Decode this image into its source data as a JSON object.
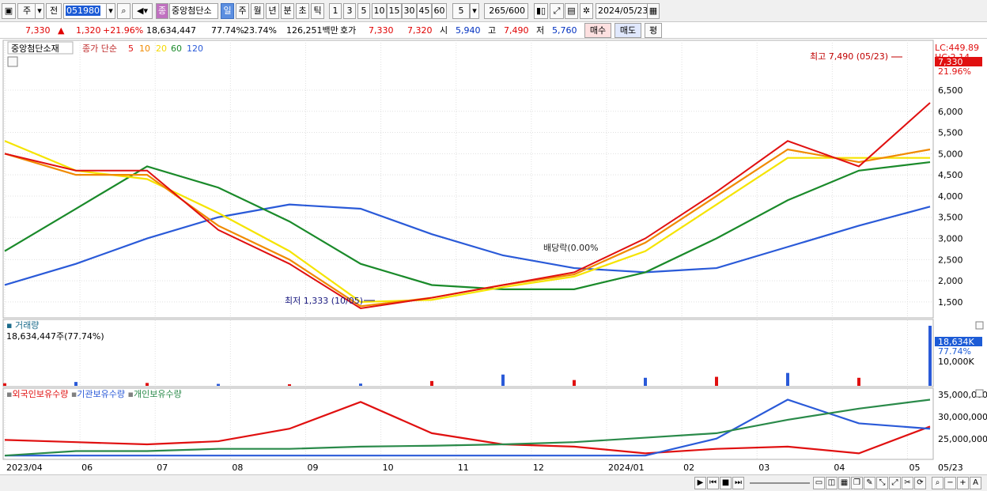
{
  "toolbar": {
    "market_label": "주",
    "prev_label": "전",
    "stock_code": "051980",
    "stock_name": "중앙첨단소",
    "stock_badge": "종",
    "periods": [
      "일",
      "주",
      "월",
      "년",
      "분",
      "초",
      "틱"
    ],
    "active_period": "일",
    "intervals": [
      "1",
      "3",
      "5",
      "10",
      "15",
      "30",
      "45",
      "60"
    ],
    "interval_select": "5",
    "count_display": "265/600",
    "date_field": "2024/05/23"
  },
  "quote": {
    "price": "7,330",
    "change_symbol": "▲",
    "change": "1,320",
    "change_pct": "+21.96%",
    "volume": "18,634,447",
    "turnover_pct": "77.74%",
    "rate2": "23.74%",
    "amount": "126,251백만",
    "hoga_label": "호가",
    "ask": "7,330",
    "bid": "7,320",
    "open_label": "시",
    "open": "5,940",
    "high_label": "고",
    "high": "7,490",
    "low_label": "저",
    "low": "5,760",
    "buy_label": "매수",
    "sell_label": "매도",
    "avg_label": "평"
  },
  "price_panel": {
    "stock_label": "중앙첨단소재",
    "ma_label": "종가 단순",
    "ma_periods": [
      "5",
      "10",
      "20",
      "60",
      "120"
    ],
    "lc_label": "LC:449.89",
    "hc_label": "HC:2.14",
    "current_tag": "7,330",
    "current_pct_tag": "21.96%",
    "high_annotation": "최고 7,490 (05/23)",
    "low_annotation": "최저 1,333 (10/05)",
    "dividend_annotation": "배당락(0.00%",
    "y_ticks": [
      "6,500",
      "6,000",
      "5,500",
      "5,000",
      "4,500",
      "4,000",
      "3,500",
      "3,000",
      "2,500",
      "2,000",
      "1,500"
    ]
  },
  "volume_panel": {
    "title": "거래량",
    "value_text": "18,634,447주(77.74%)",
    "tag": "18,634K",
    "tag_pct": "77.74%",
    "tick": "10,000K"
  },
  "holding_panel": {
    "legend": [
      "외국인보유수량",
      "기관보유수량",
      "개인보유수량"
    ],
    "y_ticks": [
      "35,000,000",
      "30,000,000",
      "25,000,000"
    ]
  },
  "x_axis": {
    "labels": [
      "2023/04",
      "06",
      "07",
      "08",
      "09",
      "10",
      "11",
      "12",
      "2024/01",
      "02",
      "03",
      "04",
      "05"
    ],
    "right_label": "05/23"
  },
  "colors": {
    "ma5": "#e01010",
    "ma10": "#f08a00",
    "ma20": "#f5e400",
    "ma60": "#1a8a2a",
    "ma120": "#2a5ad8",
    "foreign": "#e01010",
    "institution": "#2a5ad8",
    "individual": "#2a8a4a"
  },
  "chart_data": [
    {
      "type": "line",
      "title": "중앙첨단소재",
      "x": [
        "2023/04",
        "06",
        "07",
        "08",
        "09",
        "10",
        "11",
        "12",
        "2024/01",
        "02",
        "03",
        "04",
        "05",
        "05/23"
      ],
      "series": [
        {
          "name": "5",
          "values": [
            5000,
            4600,
            4600,
            3200,
            2400,
            1350,
            1600,
            1900,
            2200,
            3000,
            4100,
            5300,
            4700,
            6200
          ]
        },
        {
          "name": "10",
          "values": [
            5000,
            4500,
            4500,
            3300,
            2500,
            1400,
            1600,
            1900,
            2150,
            2900,
            4000,
            5100,
            4800,
            5100
          ]
        },
        {
          "name": "20",
          "values": [
            5300,
            4600,
            4400,
            3600,
            2700,
            1500,
            1550,
            1850,
            2100,
            2700,
            3800,
            4900,
            4900,
            4900
          ]
        },
        {
          "name": "60",
          "values": [
            2700,
            3700,
            4700,
            4200,
            3400,
            2400,
            1900,
            1800,
            1800,
            2200,
            3000,
            3900,
            4600,
            4800
          ]
        },
        {
          "name": "120",
          "values": [
            1900,
            2400,
            3000,
            3500,
            3800,
            3700,
            3100,
            2600,
            2300,
            2200,
            2300,
            2800,
            3300,
            3750
          ]
        }
      ],
      "ylim": [
        1200,
        7600
      ]
    },
    {
      "type": "bar",
      "title": "거래량",
      "categories": [
        "2023/04",
        "06",
        "07",
        "08",
        "09",
        "10",
        "11",
        "12",
        "2024/01",
        "02",
        "03",
        "04",
        "05",
        "05/23"
      ],
      "values": [
        800,
        1200,
        900,
        600,
        500,
        700,
        1500,
        3500,
        1800,
        2500,
        2800,
        4000,
        2500,
        18634
      ]
    },
    {
      "type": "line",
      "title": "보유수량",
      "x": [
        "2023/04",
        "06",
        "07",
        "08",
        "09",
        "10",
        "11",
        "12",
        "2024/01",
        "02",
        "03",
        "04",
        "05",
        "05/23"
      ],
      "series": [
        {
          "name": "외국인보유수량",
          "values": [
            25500000,
            25000000,
            24500000,
            25200000,
            28000000,
            34000000,
            27000000,
            24500000,
            24000000,
            22500000,
            23500000,
            24000000,
            22500000,
            28500000
          ]
        },
        {
          "name": "기관보유수량",
          "values": [
            22000000,
            22000000,
            22000000,
            22000000,
            22000000,
            22000000,
            22000000,
            22000000,
            22000000,
            22000000,
            25800000,
            34500000,
            29200000,
            28000000
          ]
        },
        {
          "name": "개인보유수량",
          "values": [
            22000000,
            23000000,
            23000000,
            23500000,
            23500000,
            24000000,
            24200000,
            24500000,
            25000000,
            26000000,
            27000000,
            30000000,
            32500000,
            34500000
          ]
        }
      ],
      "ylim": [
        21500000,
        36000000
      ]
    }
  ]
}
